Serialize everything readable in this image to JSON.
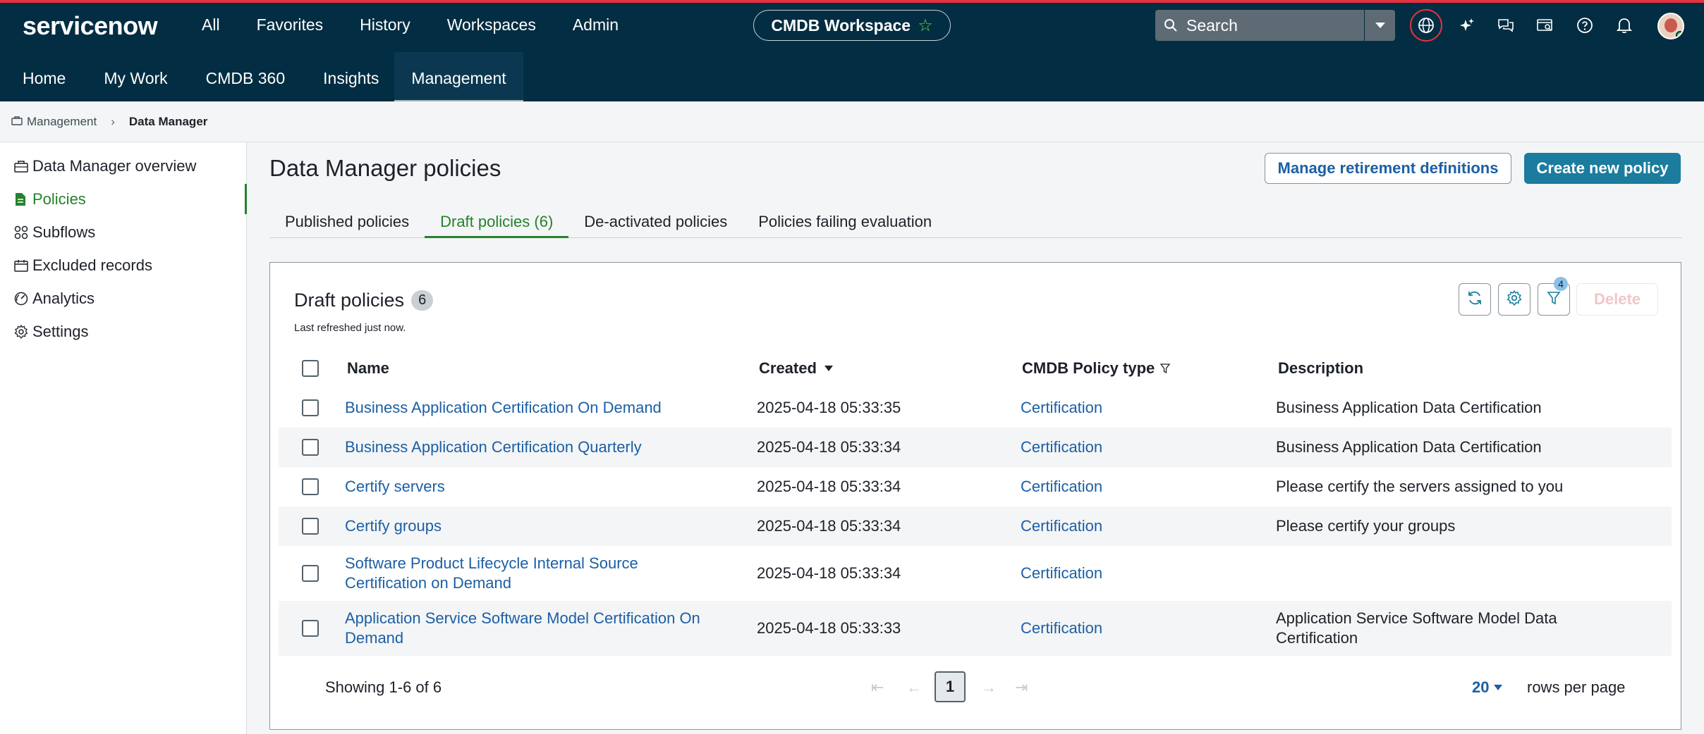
{
  "header": {
    "logo": "servicenow",
    "nav": [
      "All",
      "Favorites",
      "History",
      "Workspaces",
      "Admin"
    ],
    "workspace": "CMDB Workspace",
    "search_placeholder": "Search"
  },
  "subnav": [
    "Home",
    "My Work",
    "CMDB 360",
    "Insights",
    "Management"
  ],
  "breadcrumb": {
    "parent": "Management",
    "current": "Data Manager"
  },
  "sidebar": {
    "items": [
      {
        "label": "Data Manager overview",
        "icon": "briefcase-icon"
      },
      {
        "label": "Policies",
        "icon": "document-icon"
      },
      {
        "label": "Subflows",
        "icon": "subflows-icon"
      },
      {
        "label": "Excluded records",
        "icon": "calendar-icon"
      },
      {
        "label": "Analytics",
        "icon": "gauge-icon"
      },
      {
        "label": "Settings",
        "icon": "gear-icon"
      }
    ]
  },
  "page": {
    "title": "Data Manager policies",
    "manage_button": "Manage retirement definitions",
    "create_button": "Create new policy",
    "tabs": [
      "Published policies",
      "Draft policies (6)",
      "De-activated policies",
      "Policies failing evaluation"
    ]
  },
  "card": {
    "title": "Draft policies",
    "count": "6",
    "refreshed": "Last refreshed just now.",
    "filter_count": "4",
    "delete_label": "Delete",
    "columns": [
      "Name",
      "Created",
      "CMDB Policy type",
      "Description"
    ],
    "rows": [
      {
        "name": "Business Application Certification On Demand",
        "created": "2025-04-18 05:33:35",
        "type": "Certification",
        "desc": "Business Application Data Certification"
      },
      {
        "name": "Business Application Certification Quarterly",
        "created": "2025-04-18 05:33:34",
        "type": "Certification",
        "desc": "Business Application Data Certification"
      },
      {
        "name": "Certify servers",
        "created": "2025-04-18 05:33:34",
        "type": "Certification",
        "desc": "Please certify the servers assigned to you"
      },
      {
        "name": "Certify groups",
        "created": "2025-04-18 05:33:34",
        "type": "Certification",
        "desc": "Please certify your groups"
      },
      {
        "name": "Software Product Lifecycle Internal Source Certification on Demand",
        "created": "2025-04-18 05:33:34",
        "type": "Certification",
        "desc": ""
      },
      {
        "name": "Application Service Software Model Certification On Demand",
        "created": "2025-04-18 05:33:33",
        "type": "Certification",
        "desc": "Application Service Software Model Data Certification"
      }
    ],
    "showing": "Showing 1-6 of 6",
    "page": "1",
    "rows_per_page_value": "20",
    "rows_per_page_label": "rows per page"
  }
}
